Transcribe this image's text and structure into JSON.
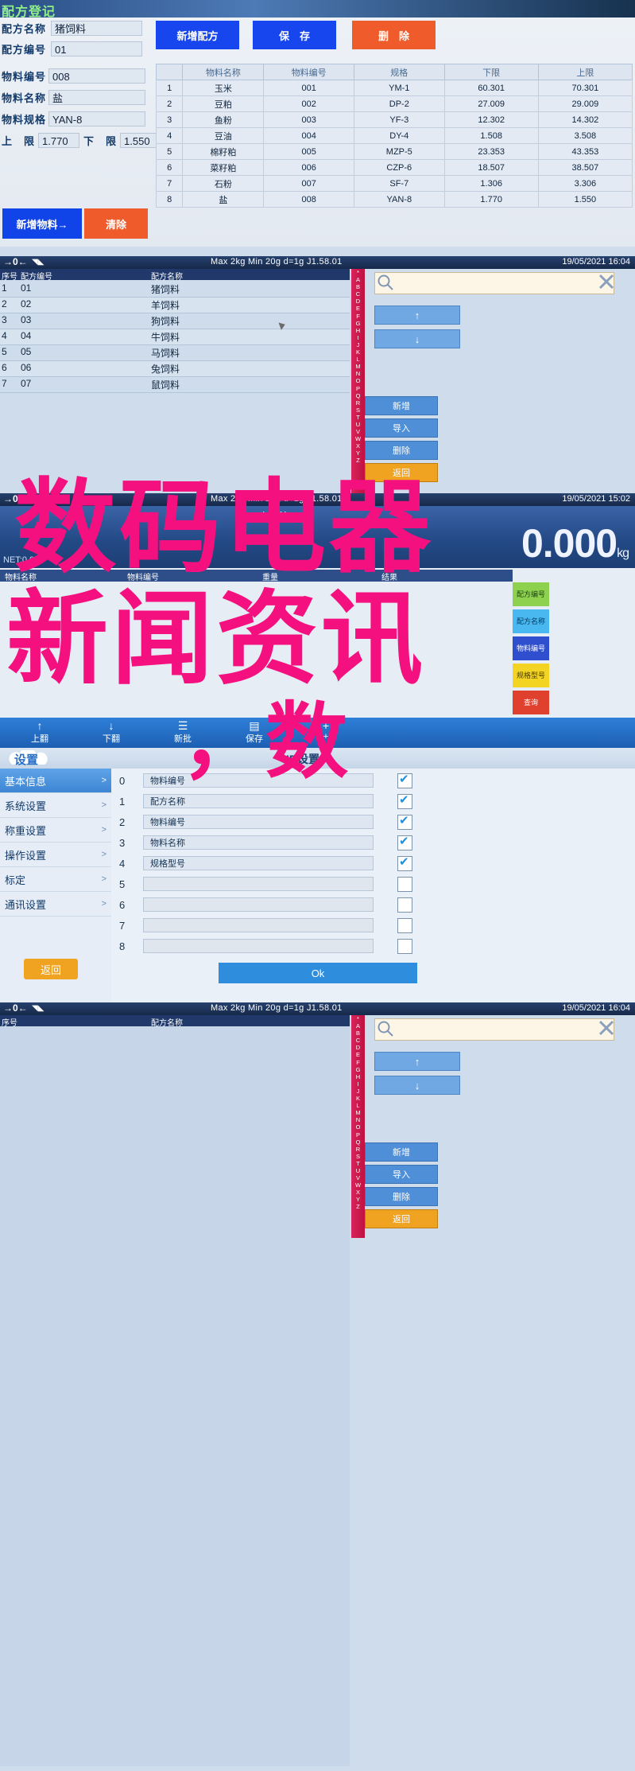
{
  "panel1": {
    "title": "配方登记",
    "fields": {
      "recipe_name_label": "配方名称",
      "recipe_name_value": "猪饲料",
      "recipe_code_label": "配方编号",
      "recipe_code_value": "01",
      "material_code_label": "物料编号",
      "material_code_value": "008",
      "material_name_label": "物料名称",
      "material_name_value": "盐",
      "material_spec_label": "物料规格",
      "material_spec_value": "YAN-8",
      "upper_label": "上　限",
      "upper_value": "1.770",
      "lower_label": "下　限",
      "lower_value": "1.550"
    },
    "buttons": {
      "add_recipe": "新增配方",
      "save": "保　存",
      "delete": "删　除",
      "add_material": "新增物料→",
      "clear": "清除"
    },
    "table": {
      "headers": [
        "",
        "物料名称",
        "物料编号",
        "规格",
        "下限",
        "上限"
      ],
      "rows": [
        [
          "1",
          "玉米",
          "001",
          "YM-1",
          "60.301",
          "70.301"
        ],
        [
          "2",
          "豆粕",
          "002",
          "DP-2",
          "27.009",
          "29.009"
        ],
        [
          "3",
          "鱼粉",
          "003",
          "YF-3",
          "12.302",
          "14.302"
        ],
        [
          "4",
          "豆油",
          "004",
          "DY-4",
          "1.508",
          "3.508"
        ],
        [
          "5",
          "棉籽粕",
          "005",
          "MZP-5",
          "23.353",
          "43.353"
        ],
        [
          "6",
          "菜籽粕",
          "006",
          "CZP-6",
          "18.507",
          "38.507"
        ],
        [
          "7",
          "石粉",
          "007",
          "SF-7",
          "1.306",
          "3.306"
        ],
        [
          "8",
          "盐",
          "008",
          "YAN-8",
          "1.770",
          "1.550"
        ]
      ]
    }
  },
  "panel2": {
    "statusbar": {
      "zero": "→0←",
      "spec": "Max 2kg  Min 20g  d=1g    J1.58.01",
      "datetime": "19/05/2021  16:04"
    },
    "list_headers": [
      "序号",
      "配方编号",
      "配方名称"
    ],
    "rows": [
      [
        "1",
        "01",
        "猪饲料"
      ],
      [
        "2",
        "02",
        "羊饲料"
      ],
      [
        "3",
        "03",
        "狗饲料"
      ],
      [
        "4",
        "04",
        "牛饲料"
      ],
      [
        "5",
        "05",
        "马饲料"
      ],
      [
        "6",
        "06",
        "兔饲料"
      ],
      [
        "7",
        "07",
        "鼠饲料"
      ]
    ],
    "alpha_index": "*ABCDEFGHIJKLMNOPQRSTUVWXYZ",
    "search_placeholder": "",
    "search_value": "",
    "buttons": {
      "up": "↑",
      "down": "↓",
      "add": "新增",
      "import": "导入",
      "delete": "删除",
      "back": "返回"
    }
  },
  "panel3": {
    "statusbar": {
      "zero": "→0←",
      "spec": "Max 2kg  Min 20g  d=1g    J1.58.01",
      "datetime": "19/05/2021  15:02"
    },
    "net_label": "NET:0.000",
    "low_label": "LOW",
    "weight": "0.000",
    "weight_unit": "kg",
    "table_headers": [
      "物料名称",
      "物料编号",
      "重量",
      "结果"
    ],
    "side_tags": [
      "配方编号",
      "配方名称",
      "物料编号",
      "规格型号",
      "查询"
    ],
    "bottom_items": [
      "上翻",
      "下翻",
      "新批",
      "保存",
      "+"
    ]
  },
  "panel4": {
    "title": "设置",
    "dialog_title": "ID设置",
    "menu": [
      {
        "label": "基本信息",
        "selected": true,
        "chevron": ">"
      },
      {
        "label": "系统设置",
        "selected": false,
        "chevron": ">"
      },
      {
        "label": "称重设置",
        "selected": false,
        "chevron": ">"
      },
      {
        "label": "操作设置",
        "selected": false,
        "chevron": ">"
      },
      {
        "label": "标定",
        "selected": false,
        "chevron": ">"
      },
      {
        "label": "通讯设置",
        "selected": false,
        "chevron": ">"
      }
    ],
    "back_button": "返回",
    "ok_button": "Ok",
    "id_rows": [
      {
        "index": "0",
        "value": "物料编号",
        "checked": true
      },
      {
        "index": "1",
        "value": "配方名称",
        "checked": true
      },
      {
        "index": "2",
        "value": "物料编号",
        "checked": true
      },
      {
        "index": "3",
        "value": "物料名称",
        "checked": true
      },
      {
        "index": "4",
        "value": "规格型号",
        "checked": true
      },
      {
        "index": "5",
        "value": "",
        "checked": false
      },
      {
        "index": "6",
        "value": "",
        "checked": false
      },
      {
        "index": "7",
        "value": "",
        "checked": false
      },
      {
        "index": "8",
        "value": "",
        "checked": false
      }
    ]
  },
  "panel5": {
    "statusbar": {
      "zero": "→0←",
      "spec": "Max 2kg  Min 20g  d=1g    J1.58.01",
      "datetime": "19/05/2021  16:04"
    },
    "list_headers": [
      "序号",
      "配方名称"
    ],
    "rows": [],
    "alpha_index": "*ABCDEFGHIJKLMNOPQRSTUVWXYZ",
    "buttons": {
      "up": "↑",
      "down": "↓",
      "add": "新增",
      "import": "导入",
      "delete": "删除",
      "back": "返回"
    }
  },
  "watermarks": {
    "line1": "数码电器",
    "line2": "新闻资讯",
    "line3": "，数"
  },
  "colors": {
    "accent_blue": "#1043e8",
    "accent_orange": "#ef5b2b",
    "title_green": "#8ff08a",
    "alpha_red": "#c01040",
    "watermark_pink": "#f4117f"
  }
}
